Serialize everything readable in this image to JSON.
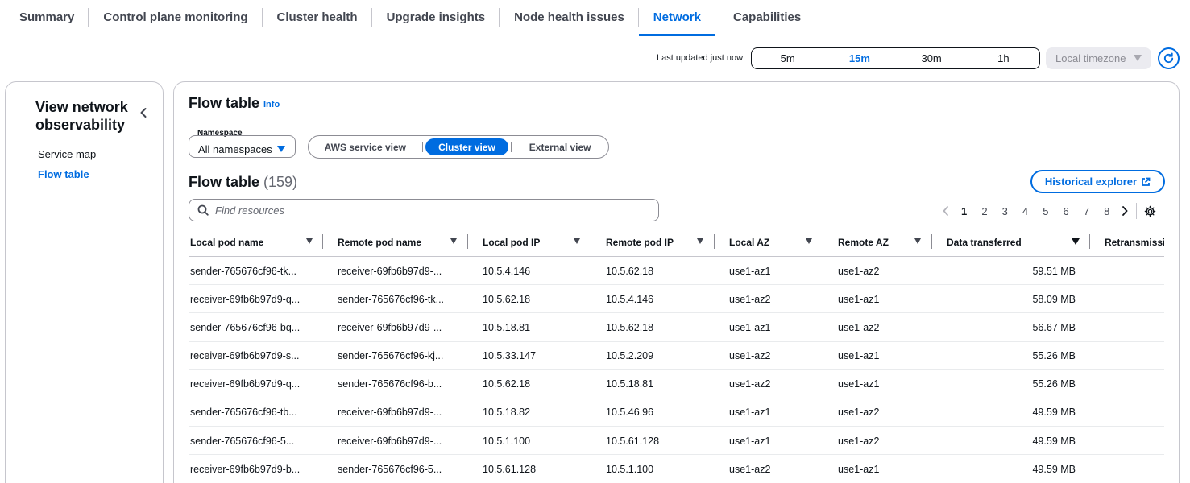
{
  "tabs": [
    {
      "label": "Summary"
    },
    {
      "label": "Control plane monitoring"
    },
    {
      "label": "Cluster health"
    },
    {
      "label": "Upgrade insights"
    },
    {
      "label": "Node health issues"
    },
    {
      "label": "Network"
    },
    {
      "label": "Capabilities"
    }
  ],
  "active_tab": "Network",
  "toolbar": {
    "last_updated": "Last updated just now",
    "time_ranges": [
      "5m",
      "15m",
      "30m",
      "1h"
    ],
    "selected_range": "15m",
    "timezone": "Local timezone"
  },
  "sidebar": {
    "title": "View network observability",
    "items": [
      {
        "label": "Service map"
      },
      {
        "label": "Flow table"
      }
    ],
    "active_item": "Flow table"
  },
  "main": {
    "title": "Flow table",
    "info": "Info",
    "namespace_label": "Namespace",
    "namespace_value": "All namespaces",
    "views": [
      "AWS service view",
      "Cluster view",
      "External view"
    ],
    "selected_view": "Cluster view",
    "table_title": "Flow table",
    "table_count": "(159)",
    "historical_button": "Historical explorer",
    "search_placeholder": "Find resources",
    "pages": [
      "1",
      "2",
      "3",
      "4",
      "5",
      "6",
      "7",
      "8"
    ],
    "current_page": "1"
  },
  "table": {
    "columns": [
      "Local pod name",
      "Remote pod name",
      "Local pod IP",
      "Remote pod IP",
      "Local AZ",
      "Remote AZ",
      "Data transferred",
      "Retransmissi"
    ],
    "rows": [
      [
        "sender-765676cf96-tk...",
        "receiver-69fb6b97d9-...",
        "10.5.4.146",
        "10.5.62.18",
        "use1-az1",
        "use1-az2",
        "59.51 MB"
      ],
      [
        "receiver-69fb6b97d9-q...",
        "sender-765676cf96-tk...",
        "10.5.62.18",
        "10.5.4.146",
        "use1-az2",
        "use1-az1",
        "58.09 MB"
      ],
      [
        "sender-765676cf96-bq...",
        "receiver-69fb6b97d9-...",
        "10.5.18.81",
        "10.5.62.18",
        "use1-az1",
        "use1-az2",
        "56.67 MB"
      ],
      [
        "receiver-69fb6b97d9-s...",
        "sender-765676cf96-kj...",
        "10.5.33.147",
        "10.5.2.209",
        "use1-az2",
        "use1-az1",
        "55.26 MB"
      ],
      [
        "receiver-69fb6b97d9-q...",
        "sender-765676cf96-b...",
        "10.5.62.18",
        "10.5.18.81",
        "use1-az2",
        "use1-az1",
        "55.26 MB"
      ],
      [
        "sender-765676cf96-tb...",
        "receiver-69fb6b97d9-...",
        "10.5.18.82",
        "10.5.46.96",
        "use1-az1",
        "use1-az2",
        "49.59 MB"
      ],
      [
        "sender-765676cf96-5...",
        "receiver-69fb6b97d9-...",
        "10.5.1.100",
        "10.5.61.128",
        "use1-az1",
        "use1-az2",
        "49.59 MB"
      ],
      [
        "receiver-69fb6b97d9-b...",
        "sender-765676cf96-5...",
        "10.5.61.128",
        "10.5.1.100",
        "use1-az2",
        "use1-az1",
        "49.59 MB"
      ]
    ]
  },
  "colors": {
    "accent": "#006ce0",
    "text": "#0f141a",
    "border": "#c6c6cd"
  }
}
